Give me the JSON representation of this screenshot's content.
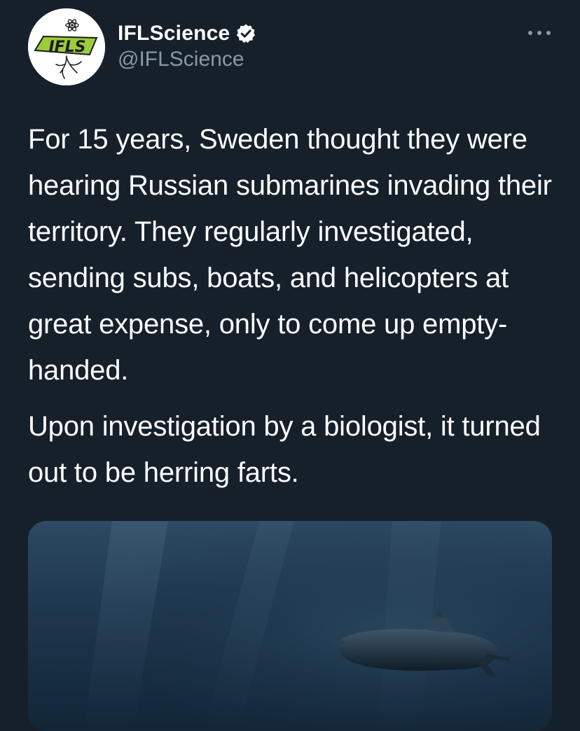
{
  "author": {
    "display_name": "IFLScience",
    "handle": "@IFLScience",
    "verified": true,
    "avatar_logo": "IFLS"
  },
  "tweet": {
    "paragraphs": [
      "For 15 years, Sweden thought they were hearing Russian submarines invading their territory. They regularly investigated, sending subs, boats, and helicopters at great expense, only to come up empty-handed.",
      "Upon investigation by a biologist, it turned out to be herring farts."
    ]
  },
  "icons": {
    "verified": "verified-badge-icon",
    "more": "more-options-icon"
  },
  "media": {
    "subject": "submarine underwater"
  },
  "colors": {
    "background": "#15202b",
    "text": "#ffffff",
    "secondary_text": "#8b98a5",
    "avatar_green": "#9ccb3b"
  }
}
